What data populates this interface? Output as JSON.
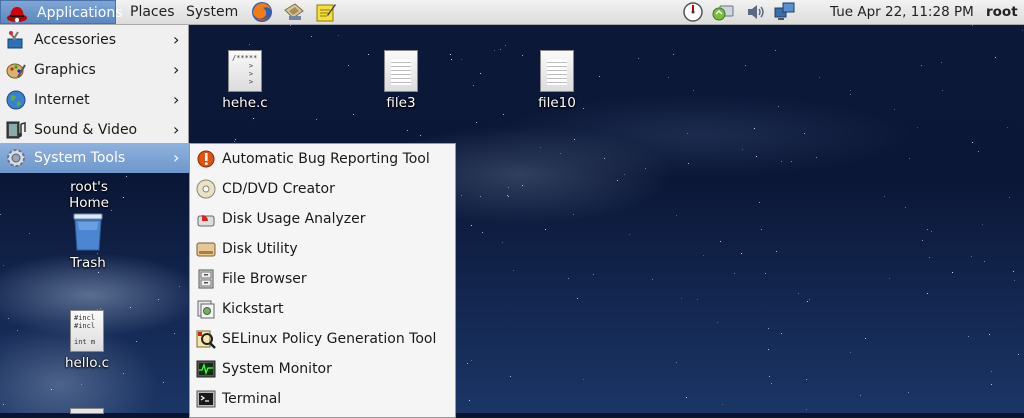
{
  "panel": {
    "applications": "Applications",
    "places": "Places",
    "system": "System",
    "launchers": [
      "firefox-icon",
      "mail-icon",
      "notes-icon"
    ],
    "tray": [
      "speedometer-icon",
      "update-icon",
      "volume-icon",
      "network-icon"
    ],
    "clock": "Tue Apr 22, 11:28 PM",
    "user": "root"
  },
  "apps_menu": {
    "items": [
      {
        "label": "Accessories",
        "icon": "accessories-icon"
      },
      {
        "label": "Graphics",
        "icon": "graphics-icon"
      },
      {
        "label": "Internet",
        "icon": "internet-icon"
      },
      {
        "label": "Sound & Video",
        "icon": "sound-video-icon"
      },
      {
        "label": "System Tools",
        "icon": "system-tools-icon",
        "active": true
      }
    ]
  },
  "system_tools": {
    "items": [
      {
        "label": "Automatic Bug Reporting Tool",
        "icon": "bug-report-icon"
      },
      {
        "label": "CD/DVD Creator",
        "icon": "disc-icon"
      },
      {
        "label": "Disk Usage Analyzer",
        "icon": "disk-usage-icon"
      },
      {
        "label": "Disk Utility",
        "icon": "disk-utility-icon"
      },
      {
        "label": "File Browser",
        "icon": "file-cabinet-icon"
      },
      {
        "label": "Kickstart",
        "icon": "kickstart-icon"
      },
      {
        "label": "SELinux Policy Generation Tool",
        "icon": "selinux-icon"
      },
      {
        "label": "System Monitor",
        "icon": "monitor-icon"
      },
      {
        "label": "Terminal",
        "icon": "terminal-icon"
      }
    ]
  },
  "desktop": {
    "icons": [
      {
        "label": "hehe.c",
        "preview": "/*****\n    >\n    >\n    >"
      },
      {
        "label": "file3"
      },
      {
        "label": "file10"
      },
      {
        "label": "root's Home"
      },
      {
        "label": "Trash"
      },
      {
        "label": "hello.c",
        "preview": "#incl\n#incl\n\nint m"
      }
    ]
  },
  "colors": {
    "menu_highlight": "#7aa1d3",
    "panel_bg": "#e6e6e6",
    "desktop_bg": "#0c1838"
  }
}
